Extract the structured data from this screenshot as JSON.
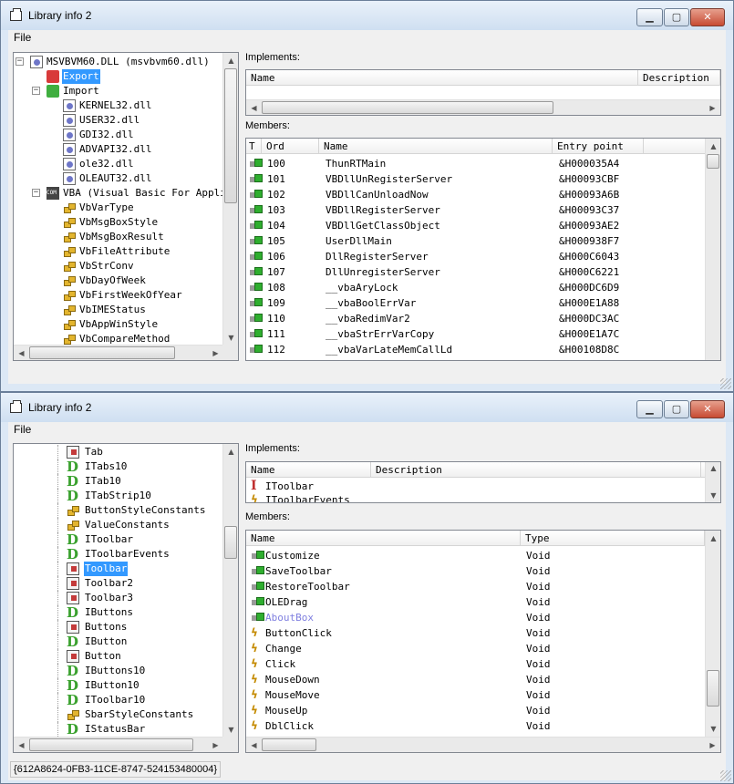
{
  "windows": [
    {
      "title": "Library info 2",
      "menu": {
        "file": "File"
      },
      "tree": [
        {
          "label": "MSVBVM60.DLL (msvbvm60.dll)",
          "icon": "dll-icon",
          "expander": "minus",
          "level": 0
        },
        {
          "label": "Export",
          "icon": "export-icon",
          "level": 1,
          "selected": true
        },
        {
          "label": "Import",
          "icon": "import-icon",
          "expander": "minus",
          "level": 1
        },
        {
          "label": "KERNEL32.dll",
          "icon": "dll-icon",
          "level": 2
        },
        {
          "label": "USER32.dll",
          "icon": "dll-icon",
          "level": 2
        },
        {
          "label": "GDI32.dll",
          "icon": "dll-icon",
          "level": 2
        },
        {
          "label": "ADVAPI32.dll",
          "icon": "dll-icon",
          "level": 2
        },
        {
          "label": "ole32.dll",
          "icon": "dll-icon",
          "level": 2
        },
        {
          "label": "OLEAUT32.dll",
          "icon": "dll-icon",
          "level": 2
        },
        {
          "label": "VBA (Visual Basic For Applications)",
          "icon": "com-icon",
          "expander": "minus",
          "level": 1
        },
        {
          "label": "VbVarType",
          "icon": "enum-icon",
          "level": 2
        },
        {
          "label": "VbMsgBoxStyle",
          "icon": "enum-icon",
          "level": 2
        },
        {
          "label": "VbMsgBoxResult",
          "icon": "enum-icon",
          "level": 2
        },
        {
          "label": "VbFileAttribute",
          "icon": "enum-icon",
          "level": 2
        },
        {
          "label": "VbStrConv",
          "icon": "enum-icon",
          "level": 2
        },
        {
          "label": "VbDayOfWeek",
          "icon": "enum-icon",
          "level": 2
        },
        {
          "label": "VbFirstWeekOfYear",
          "icon": "enum-icon",
          "level": 2
        },
        {
          "label": "VbIMEStatus",
          "icon": "enum-icon",
          "level": 2
        },
        {
          "label": "VbAppWinStyle",
          "icon": "enum-icon",
          "level": 2
        },
        {
          "label": "VbCompareMethod",
          "icon": "enum-icon",
          "level": 2
        }
      ],
      "implements": {
        "label": "Implements:",
        "columns": [
          "Name",
          "Description"
        ],
        "rows": []
      },
      "members": {
        "label": "Members:",
        "columns": [
          "T",
          "Ord",
          "Name",
          "Entry point"
        ],
        "rows": [
          {
            "ord": "100",
            "name": "ThunRTMain",
            "entry": "&H000035A4"
          },
          {
            "ord": "101",
            "name": "VBDllUnRegisterServer",
            "entry": "&H00093CBF"
          },
          {
            "ord": "102",
            "name": "VBDllCanUnloadNow",
            "entry": "&H00093A6B"
          },
          {
            "ord": "103",
            "name": "VBDllRegisterServer",
            "entry": "&H00093C37"
          },
          {
            "ord": "104",
            "name": "VBDllGetClassObject",
            "entry": "&H00093AE2"
          },
          {
            "ord": "105",
            "name": "UserDllMain",
            "entry": "&H000938F7"
          },
          {
            "ord": "106",
            "name": "DllRegisterServer",
            "entry": "&H000C6043"
          },
          {
            "ord": "107",
            "name": "DllUnregisterServer",
            "entry": "&H000C6221"
          },
          {
            "ord": "108",
            "name": "__vbaAryLock",
            "entry": "&H000DC6D9"
          },
          {
            "ord": "109",
            "name": "__vbaBoolErrVar",
            "entry": "&H000E1A88"
          },
          {
            "ord": "110",
            "name": "__vbaRedimVar2",
            "entry": "&H000DC3AC"
          },
          {
            "ord": "111",
            "name": "__vbaStrErrVarCopy",
            "entry": "&H000E1A7C"
          },
          {
            "ord": "112",
            "name": "__vbaVarLateMemCallLd",
            "entry": "&H00108D8C"
          }
        ]
      }
    },
    {
      "title": "Library info 2",
      "menu": {
        "file": "File"
      },
      "tree": [
        {
          "label": "Tab",
          "icon": "class-icon"
        },
        {
          "label": "ITabs10",
          "icon": "interface-d-icon"
        },
        {
          "label": "ITab10",
          "icon": "interface-d-icon"
        },
        {
          "label": "ITabStrip10",
          "icon": "interface-d-icon"
        },
        {
          "label": "ButtonStyleConstants",
          "icon": "enum-icon"
        },
        {
          "label": "ValueConstants",
          "icon": "enum-icon"
        },
        {
          "label": "IToolbar",
          "icon": "interface-d-icon"
        },
        {
          "label": "IToolbarEvents",
          "icon": "interface-d-icon"
        },
        {
          "label": "Toolbar",
          "icon": "class-icon",
          "selected": true
        },
        {
          "label": "Toolbar2",
          "icon": "class-icon"
        },
        {
          "label": "Toolbar3",
          "icon": "class-icon"
        },
        {
          "label": "IButtons",
          "icon": "interface-d-icon"
        },
        {
          "label": "Buttons",
          "icon": "class-icon"
        },
        {
          "label": "IButton",
          "icon": "interface-d-icon"
        },
        {
          "label": "Button",
          "icon": "class-icon"
        },
        {
          "label": "IButtons10",
          "icon": "interface-d-icon"
        },
        {
          "label": "IButton10",
          "icon": "interface-d-icon"
        },
        {
          "label": "IToolbar10",
          "icon": "interface-d-icon"
        },
        {
          "label": "SbarStyleConstants",
          "icon": "enum-icon"
        },
        {
          "label": "IStatusBar",
          "icon": "interface-d-icon"
        }
      ],
      "implements": {
        "label": "Implements:",
        "columns": [
          "Name",
          "Description"
        ],
        "rows": [
          {
            "name": "IToolbar",
            "icon": "interface-i-icon"
          },
          {
            "name": "IToolbarEvents",
            "icon": "event-icon"
          }
        ]
      },
      "members": {
        "label": "Members:",
        "columns": [
          "Name",
          "Type"
        ],
        "rows": [
          {
            "name": "Customize",
            "type": "Void",
            "icon": "method-icon"
          },
          {
            "name": "SaveToolbar",
            "type": "Void",
            "icon": "method-icon"
          },
          {
            "name": "RestoreToolbar",
            "type": "Void",
            "icon": "method-icon"
          },
          {
            "name": "OLEDrag",
            "type": "Void",
            "icon": "method-icon"
          },
          {
            "name": "AboutBox",
            "type": "Void",
            "icon": "method-icon",
            "hidden": true
          },
          {
            "name": "ButtonClick",
            "type": "Void",
            "icon": "event-icon"
          },
          {
            "name": "Change",
            "type": "Void",
            "icon": "event-icon"
          },
          {
            "name": "Click",
            "type": "Void",
            "icon": "event-icon"
          },
          {
            "name": "MouseDown",
            "type": "Void",
            "icon": "event-icon"
          },
          {
            "name": "MouseMove",
            "type": "Void",
            "icon": "event-icon"
          },
          {
            "name": "MouseUp",
            "type": "Void",
            "icon": "event-icon"
          },
          {
            "name": "DblClick",
            "type": "Void",
            "icon": "event-icon"
          }
        ]
      },
      "status": "{612A8624-0FB3-11CE-8747-524153480004}"
    }
  ],
  "colors": {
    "selection": "#3399ff",
    "hidden_member": "#8080e0",
    "window_frame": "#dce8f5"
  }
}
